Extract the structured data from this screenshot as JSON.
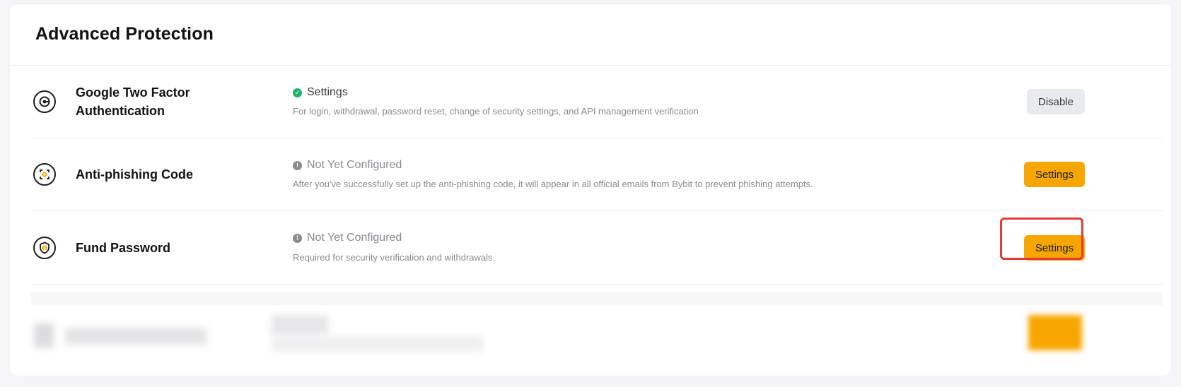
{
  "card": {
    "title": "Advanced Protection"
  },
  "rows": [
    {
      "icon": "google-authenticator-icon",
      "title_line1": "Google Two Factor",
      "title_line2": "Authentication",
      "status_icon": "check-circle-icon",
      "status": "Settings",
      "status_color": "#20b26c",
      "description": "For login, withdrawal, password reset, change of security settings, and API management verification",
      "button_label": "Disable"
    },
    {
      "icon": "anti-phishing-icon",
      "title": "Anti-phishing Code",
      "status_icon": "info-circle-icon",
      "status": "Not Yet Configured",
      "status_color": "#8a8a90",
      "description": "After you've successfully set up the anti-phishing code, it will appear in all official emails from Bybit to prevent phishing attempts.",
      "button_label": "Settings"
    },
    {
      "icon": "shield-dollar-icon",
      "title": "Fund Password",
      "status_icon": "info-circle-icon",
      "status": "Not Yet Configured",
      "status_color": "#8a8a90",
      "description": "Required for security verification and withdrawals.",
      "button_label": "Settings"
    }
  ],
  "colors": {
    "accent": "#f7a600",
    "success": "#20b26c",
    "highlight": "#e53935"
  }
}
